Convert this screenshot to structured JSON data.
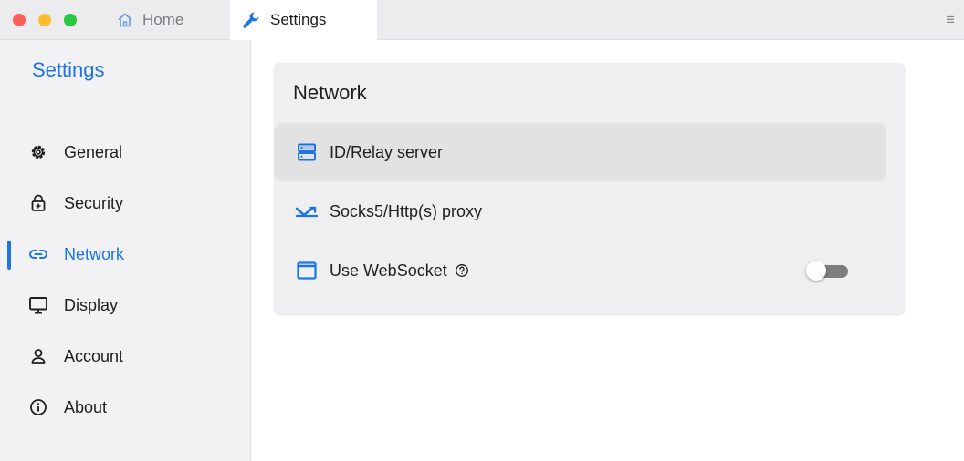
{
  "titlebar": {
    "tabs": [
      {
        "label": "Home",
        "icon": "home-icon"
      },
      {
        "label": "Settings",
        "icon": "wrench-icon"
      }
    ],
    "menu_icon": "hamburger-menu-icon"
  },
  "sidebar": {
    "title": "Settings",
    "items": [
      {
        "label": "General",
        "icon": "gear-icon"
      },
      {
        "label": "Security",
        "icon": "lock-icon"
      },
      {
        "label": "Network",
        "icon": "link-icon",
        "active": true
      },
      {
        "label": "Display",
        "icon": "monitor-icon"
      },
      {
        "label": "Account",
        "icon": "person-icon"
      },
      {
        "label": "About",
        "icon": "info-icon"
      }
    ]
  },
  "main": {
    "section_title": "Network",
    "rows": [
      {
        "label": "ID/Relay server",
        "icon": "server-icon"
      },
      {
        "label": "Socks5/Http(s) proxy",
        "icon": "proxy-icon"
      },
      {
        "label": "Use WebSocket",
        "icon": "window-icon",
        "help_icon": "help-circle-icon",
        "toggle_on": false
      }
    ]
  },
  "colors": {
    "accent": "#1b74e8",
    "sidebar_bg": "#f2f2f4",
    "card_bg": "#efeff1",
    "toggle_track": "#7d7d80"
  }
}
